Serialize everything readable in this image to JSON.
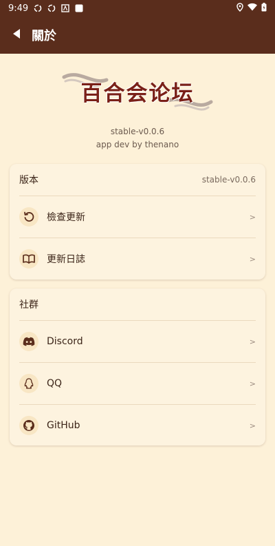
{
  "status_bar": {
    "time": "9:49"
  },
  "app_bar": {
    "title": "關於"
  },
  "logo": {
    "text": "百合会论坛"
  },
  "about": {
    "version": "stable-v0.0.6",
    "developer": "app dev by thenano"
  },
  "version_card": {
    "header": "版本",
    "header_value": "stable-v0.0.6",
    "items": [
      {
        "label": "檢查更新",
        "icon": "refresh-icon",
        "chevron": ">"
      },
      {
        "label": "更新日誌",
        "icon": "book-icon",
        "chevron": ">"
      }
    ]
  },
  "social_card": {
    "header": "社群",
    "items": [
      {
        "label": "Discord",
        "icon": "discord-icon",
        "chevron": ">"
      },
      {
        "label": "QQ",
        "icon": "qq-icon",
        "chevron": ">"
      },
      {
        "label": "GitHub",
        "icon": "github-icon",
        "chevron": ">"
      }
    ]
  },
  "colors": {
    "primary": "#5a2d1c",
    "background": "#fdf1d8",
    "card": "#fdf3df",
    "icon_bg": "#f8e6c4"
  }
}
